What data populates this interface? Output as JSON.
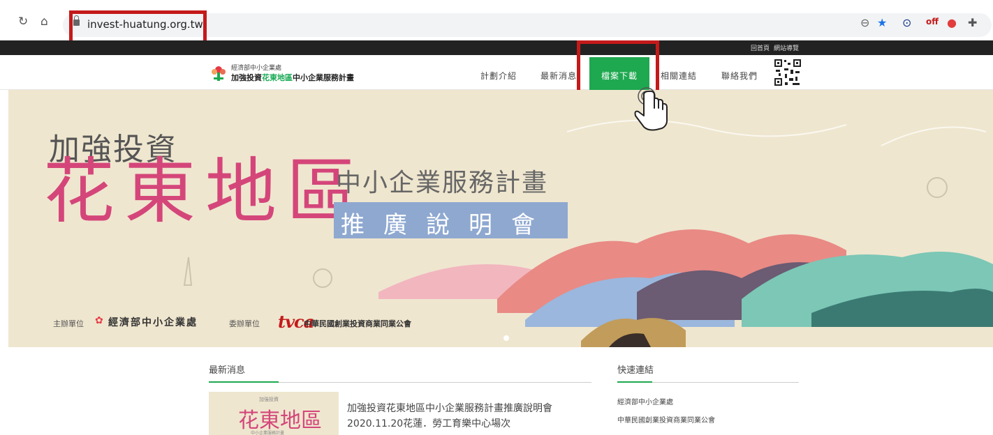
{
  "browser": {
    "url": "invest-huatung.org.tw"
  },
  "topbar": {
    "links": [
      "回首頁",
      "網站導覽"
    ]
  },
  "header": {
    "org": "經濟部中小企業處",
    "title_a": "加強投資",
    "title_b": "花東地區",
    "title_c": "中小企業服務計畫",
    "menu": [
      "計劃介紹",
      "最新消息",
      "檔案下載",
      "相關連結",
      "聯絡我們"
    ],
    "active_menu": "檔案下載"
  },
  "banner": {
    "line1": "加強投資",
    "big": "花東地區",
    "sub": "中小企業服務計畫",
    "tag": "推廣說明會",
    "host_label": "主辦單位",
    "host_org": "經濟部中小企業處",
    "co_label": "委辦單位",
    "co_logo": "tvca",
    "co_org": "中華民國創業投資商業同業公會"
  },
  "news": {
    "title": "最新消息",
    "thumb_small": "加強投資",
    "thumb_big": "花東地區",
    "thumb_sub": "中小企業服務計畫",
    "item_title": "加強投資花東地區中小企業服務計畫推廣說明會",
    "item_date": "2020.11.20花蓮．勞工育樂中心場次"
  },
  "quick_links": {
    "title": "快速連結",
    "items": [
      "經濟部中小企業處",
      "中華民國創業投資商業同業公會"
    ]
  },
  "colors": {
    "green": "#1ea84f",
    "pink": "#d4467a",
    "highlight_red": "#c41a1a",
    "banner_bg": "#efe6cf"
  }
}
